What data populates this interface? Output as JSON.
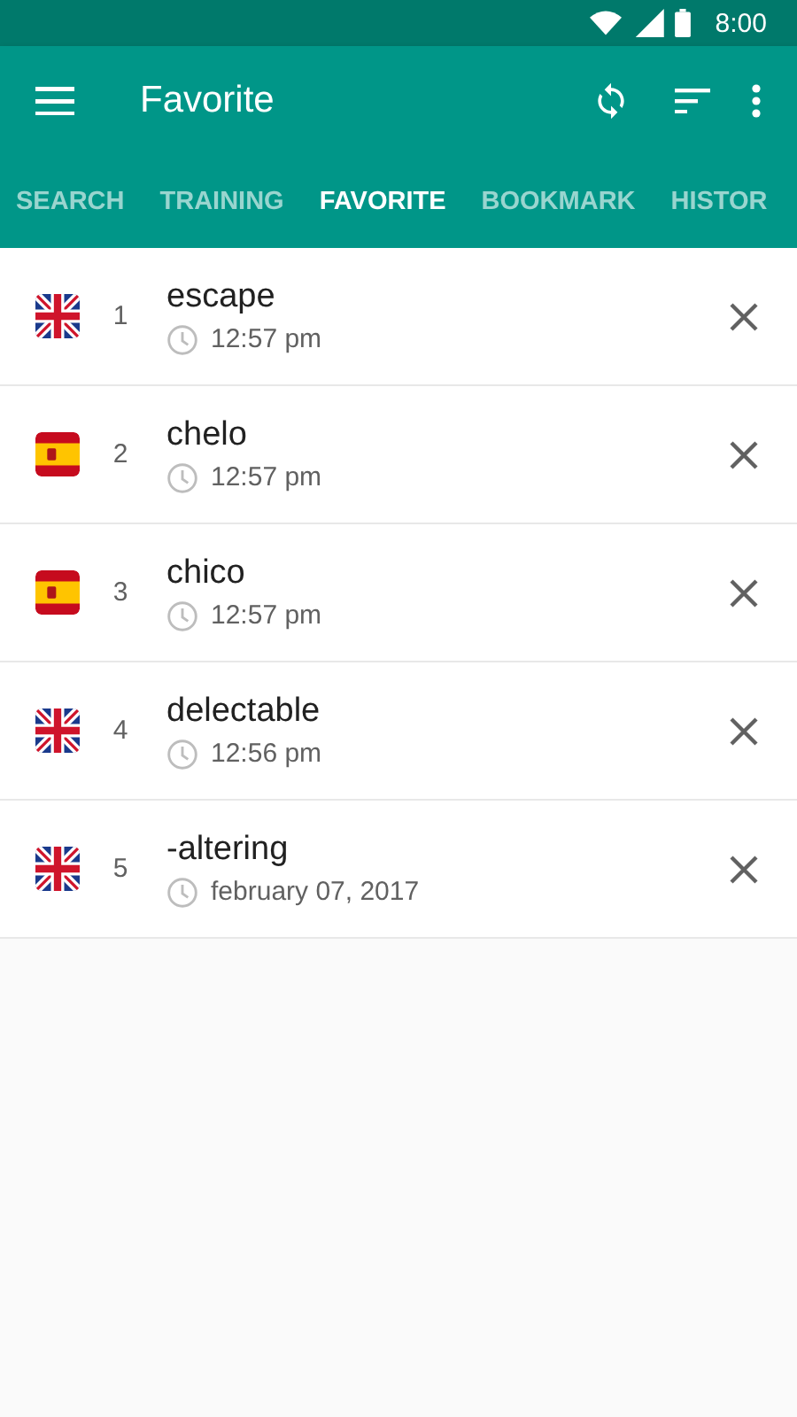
{
  "status_bar": {
    "time": "8:00"
  },
  "toolbar": {
    "title": "Favorite"
  },
  "tabs": [
    {
      "label": "SEARCH",
      "selected": false
    },
    {
      "label": "TRAINING",
      "selected": false
    },
    {
      "label": "FAVORITE",
      "selected": true
    },
    {
      "label": "BOOKMARK",
      "selected": false
    },
    {
      "label": "HISTOR",
      "selected": false
    }
  ],
  "items": [
    {
      "kind": "uk",
      "number": "1",
      "word": "escape",
      "time": "12:57 pm"
    },
    {
      "kind": "es",
      "number": "2",
      "word": "chelo",
      "time": "12:57 pm"
    },
    {
      "kind": "es",
      "number": "3",
      "word": "chico",
      "time": "12:57 pm"
    },
    {
      "kind": "uk",
      "number": "4",
      "word": "delectable",
      "time": "12:56 pm"
    },
    {
      "kind": "uk",
      "number": "5",
      "word": "-altering",
      "time": "february 07, 2017"
    }
  ]
}
